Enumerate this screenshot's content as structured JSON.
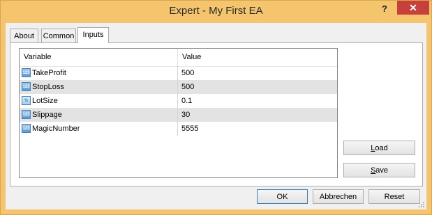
{
  "window": {
    "title": "Expert - My First EA",
    "help_label": "?",
    "close_label": "✕"
  },
  "tabs": [
    {
      "label": "About",
      "active": false
    },
    {
      "label": "Common",
      "active": false
    },
    {
      "label": "Inputs",
      "active": true
    }
  ],
  "grid": {
    "headers": {
      "variable": "Variable",
      "value": "Value"
    },
    "rows": [
      {
        "variable": "TakeProfit",
        "value": "500",
        "icon": "integer-icon",
        "icon_text": "123"
      },
      {
        "variable": "StopLoss",
        "value": "500",
        "icon": "integer-icon",
        "icon_text": "123"
      },
      {
        "variable": "LotSize",
        "value": "0.1",
        "icon": "double-icon",
        "icon_text": "½"
      },
      {
        "variable": "Slippage",
        "value": "30",
        "icon": "integer-icon",
        "icon_text": "123"
      },
      {
        "variable": "MagicNumber",
        "value": "5555",
        "icon": "integer-icon",
        "icon_text": "123"
      }
    ]
  },
  "side_buttons": {
    "load_first": "L",
    "load_rest": "oad",
    "save_first": "S",
    "save_rest": "ave"
  },
  "footer": {
    "ok_label": "OK",
    "cancel_label": "Abbrechen",
    "reset_label": "Reset"
  },
  "colors": {
    "titlebar": "#f5c56e",
    "close": "#c7403a",
    "alt_row": "#e3e3e3"
  }
}
